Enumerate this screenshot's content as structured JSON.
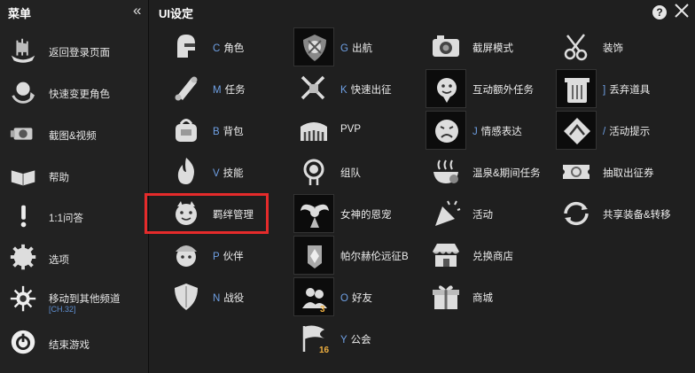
{
  "sidebar": {
    "title": "菜单",
    "collapse_icon": "double-chevron-left-icon",
    "items": [
      {
        "label": "返回登录页面",
        "icon": "viking-ship-icon"
      },
      {
        "label": "快速变更角色",
        "icon": "character-swap-icon"
      },
      {
        "label": "截图&视频",
        "icon": "camera-icon"
      },
      {
        "label": "帮助",
        "icon": "book-icon"
      },
      {
        "label": "1:1问答",
        "icon": "exclamation-icon"
      },
      {
        "label": "选项",
        "icon": "gear-icon"
      },
      {
        "label": "移动到其他频道",
        "sub": "[CH.32]",
        "icon": "channel-sun-icon"
      },
      {
        "label": "结束游戏",
        "icon": "power-icon"
      }
    ]
  },
  "main": {
    "title": "UI设定",
    "help_label": "?",
    "columns": [
      [
        {
          "hotkey": "C",
          "label": "角色",
          "icon": "helmet-icon"
        },
        {
          "hotkey": "M",
          "label": "任务",
          "icon": "scroll-icon"
        },
        {
          "hotkey": "B",
          "label": "背包",
          "icon": "bag-icon"
        },
        {
          "hotkey": "V",
          "label": "技能",
          "icon": "flame-skill-icon"
        },
        {
          "hotkey": "",
          "label": "羁绊管理",
          "icon": "pet-face-icon"
        },
        {
          "hotkey": "P",
          "label": "伙伴",
          "icon": "companion-icon"
        },
        {
          "hotkey": "N",
          "label": "战役",
          "icon": "shield-icon"
        }
      ],
      [
        {
          "hotkey": "G",
          "label": "出航",
          "icon": "ship-emblem-icon",
          "boxed": true
        },
        {
          "hotkey": "K",
          "label": "快速出征",
          "icon": "crossed-swords-icon",
          "boxed": false
        },
        {
          "hotkey": "",
          "label": "PVP",
          "icon": "colosseum-icon",
          "boxed": false
        },
        {
          "hotkey": "",
          "label": "组队",
          "icon": "party-wreath-icon",
          "boxed": false
        },
        {
          "hotkey": "",
          "label": "女神的恩宠",
          "icon": "goddess-wings-icon",
          "boxed": true
        },
        {
          "hotkey": "",
          "label": "帕尔赫伦远征B",
          "icon": "expedition-banner-icon",
          "boxed": true
        },
        {
          "hotkey": "O",
          "label": "好友",
          "icon": "friends-icon",
          "boxed": true,
          "badge": "3"
        },
        {
          "hotkey": "Y",
          "label": "公会",
          "icon": "guild-flag-icon",
          "boxed": false,
          "badge": "16"
        }
      ],
      [
        {
          "hotkey": "",
          "label": "截屏模式",
          "icon": "photo-camera-icon",
          "boxed": false
        },
        {
          "hotkey": "",
          "label": "互动额外任务",
          "icon": "interaction-icon",
          "boxed": true
        },
        {
          "hotkey": "J",
          "label": "情感表达",
          "icon": "emotion-face-icon",
          "boxed": true
        },
        {
          "hotkey": "",
          "label": "温泉&期间任务",
          "icon": "hot-spring-icon",
          "boxed": false
        },
        {
          "hotkey": "",
          "label": "活动",
          "icon": "party-popper-icon",
          "boxed": false
        },
        {
          "hotkey": "",
          "label": "兑换商店",
          "icon": "shop-stall-icon",
          "boxed": false
        },
        {
          "hotkey": "",
          "label": "商城",
          "icon": "gift-box-icon",
          "boxed": false
        }
      ],
      [
        {
          "hotkey": "",
          "label": "装饰",
          "icon": "scissors-comb-icon",
          "boxed": false
        },
        {
          "hotkey": "]",
          "label": "丢弃道具",
          "icon": "trash-can-icon",
          "boxed": true
        },
        {
          "hotkey": "/",
          "label": "活动提示",
          "icon": "event-alert-icon",
          "boxed": true
        },
        {
          "hotkey": "",
          "label": "抽取出征券",
          "icon": "ticket-icon",
          "boxed": false
        },
        {
          "hotkey": "",
          "label": "共享装备&转移",
          "icon": "share-cycle-icon",
          "boxed": false
        }
      ]
    ]
  },
  "colors": {
    "background": "#1f1f1f",
    "sidebar": "#222222",
    "hotkey": "#6fa0e4",
    "highlight": "#e52b2b",
    "badge": "#f0b040"
  }
}
